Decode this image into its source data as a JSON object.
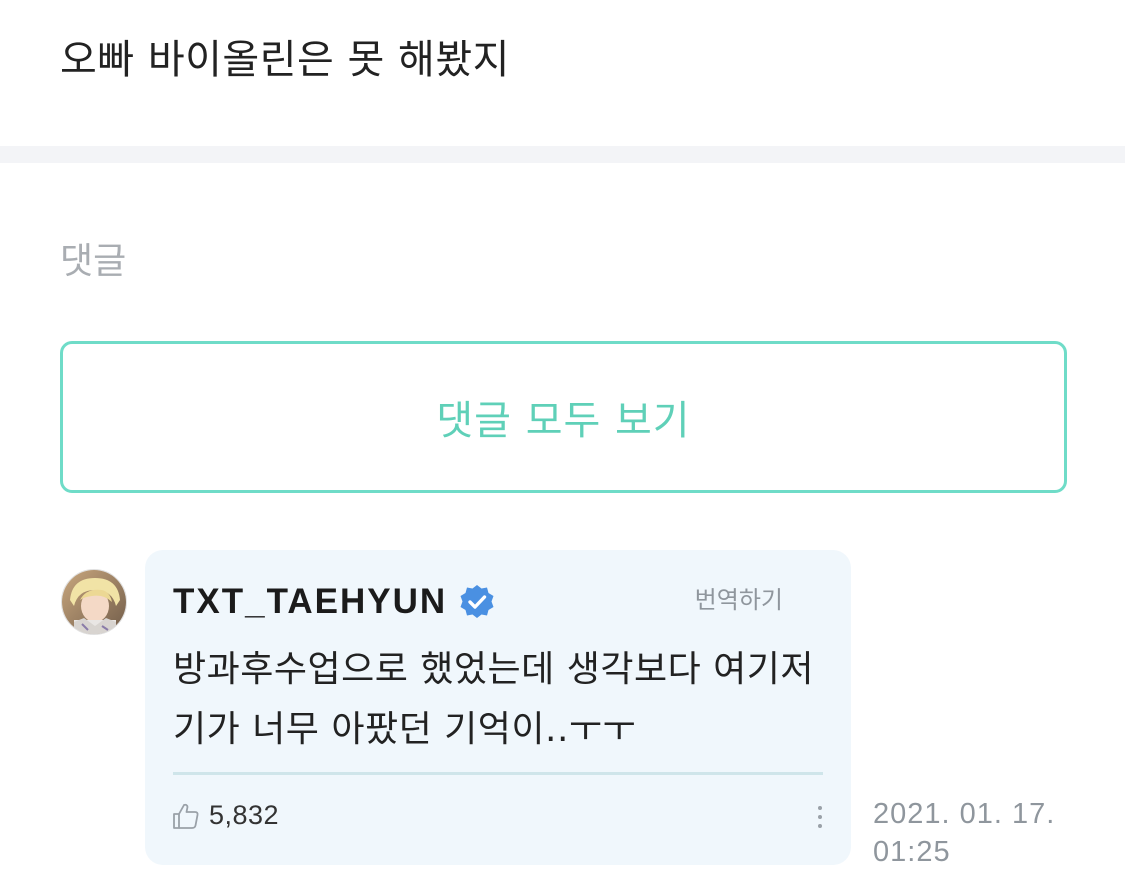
{
  "post": {
    "text": "오빠 바이올린은 못 해봤지"
  },
  "comments_section": {
    "label": "댓글",
    "view_all_label": "댓글 모두 보기"
  },
  "comment": {
    "author": "TXT_TAEHYUN",
    "verified_icon": "verified-badge-icon",
    "translate_label": "번역하기",
    "text": "방과후수업으로 했었는데 생각보다 여기저기가 너무 아팠던 기억이..ㅜㅜ",
    "like_count": "5,832",
    "like_icon": "thumbs-up-icon",
    "more_icon": "more-vertical-icon",
    "timestamp_date": "2021. 01. 17.",
    "timestamp_time": "01:25"
  },
  "colors": {
    "accent": "#5fd0b8",
    "verified": "#4a90e2",
    "bubble_bg": "#f0f7fc"
  }
}
